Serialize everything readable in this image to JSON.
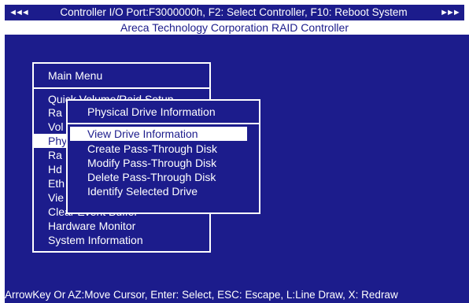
{
  "header": {
    "left_arrows": "◄◄◄",
    "title": "Controller I/O Port:F3000000h, F2: Select Controller, F10: Reboot System",
    "right_arrows": "►►►",
    "subtitle": "Areca Technology Corporation RAID Controller"
  },
  "main_menu": {
    "title": "Main Menu",
    "items": [
      "Quick Volume/Raid Setup",
      "Ra",
      "Vol",
      "Phy",
      "Ra",
      "Hd",
      "Eth",
      "Vie",
      "Clear Event Buffer",
      "Hardware Monitor",
      "System Information"
    ],
    "selected_index": 3
  },
  "sub_menu": {
    "title": "Physical Drive Information",
    "items": [
      "View Drive Information",
      "Create Pass-Through Disk",
      "Modify Pass-Through Disk",
      "Delete Pass-Through Disk",
      "Identify Selected Drive"
    ],
    "selected_index": 0
  },
  "status_bar": {
    "text": "ArrowKey Or AZ:Move Cursor, Enter: Select, ESC: Escape, L:Line Draw, X: Redraw"
  },
  "colors": {
    "background": "#1c1c8c",
    "text": "#ffffff",
    "highlight": "#ffffff"
  }
}
